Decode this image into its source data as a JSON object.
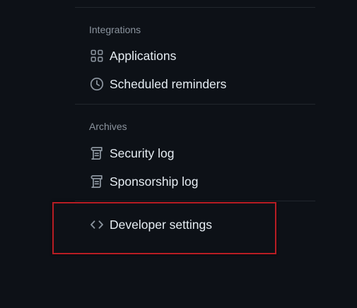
{
  "sections": [
    {
      "heading": "Integrations",
      "items": [
        {
          "label": "Applications",
          "icon": "apps-grid-icon"
        },
        {
          "label": "Scheduled reminders",
          "icon": "clock-icon"
        }
      ]
    },
    {
      "heading": "Archives",
      "items": [
        {
          "label": "Security log",
          "icon": "log-icon"
        },
        {
          "label": "Sponsorship log",
          "icon": "log-icon"
        }
      ]
    }
  ],
  "developer": {
    "label": "Developer settings",
    "icon": "code-icon"
  },
  "colors": {
    "background": "#0d1117",
    "text": "#e6edf3",
    "muted": "#8b949e",
    "divider": "#21262d",
    "highlight": "#b81d24"
  }
}
